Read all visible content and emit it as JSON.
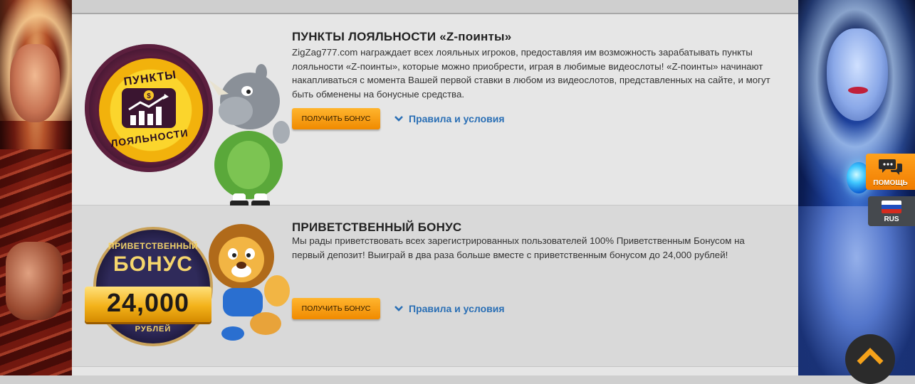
{
  "promotions": [
    {
      "title": "ПУНКТЫ ЛОЯЛЬНОСТИ «Z-поинты»",
      "description": "ZigZag777.com награждает всех лояльных игроков, предоставляя им возможность зарабатывать пункты лояльности «Z-поинты», которые можно приобрести, играя в любимые видеослоты! «Z-поинты» начинают накапливаться с момента Вашей первой ставки в любом из видеослотов, представленных на сайте, и могут быть обменены на бонусные средства.",
      "button_label": "ПОЛУЧИТЬ БОНУС",
      "rules_label": "Правила и условия",
      "badge": {
        "text_top": "ПУНКТЫ",
        "text_bottom": "ЛОЯЛЬНОСТИ"
      }
    },
    {
      "title": "ПРИВЕТСТВЕННЫЙ БОНУС",
      "description": "Мы рады приветствовать всех зарегистрированных пользователей 100% Приветственным Бонусом на первый депозит! Выиграй в два раза больше вместе с приветственным бонусом до 24,000 рублей!",
      "button_label": "ПОЛУЧИТЬ БОНУС",
      "rules_label": "Правила и условия",
      "badge": {
        "text_top": "ПРИВЕТСТВЕННЫЙ",
        "text_mid": "БОНУС",
        "amount": "24,000",
        "currency": "РУБЛЕЙ"
      }
    }
  ],
  "widgets": {
    "help_label": "ПОМОЩЬ",
    "lang_label": "RUS"
  },
  "colors": {
    "accent_orange": "#f59a0c",
    "link_blue": "#2a6fb5",
    "text_dark": "#222222"
  },
  "icons": [
    "chat-bubbles-icon",
    "russia-flag-icon",
    "chevron-down-icon",
    "chevron-up-icon",
    "coin-chart-icon"
  ]
}
